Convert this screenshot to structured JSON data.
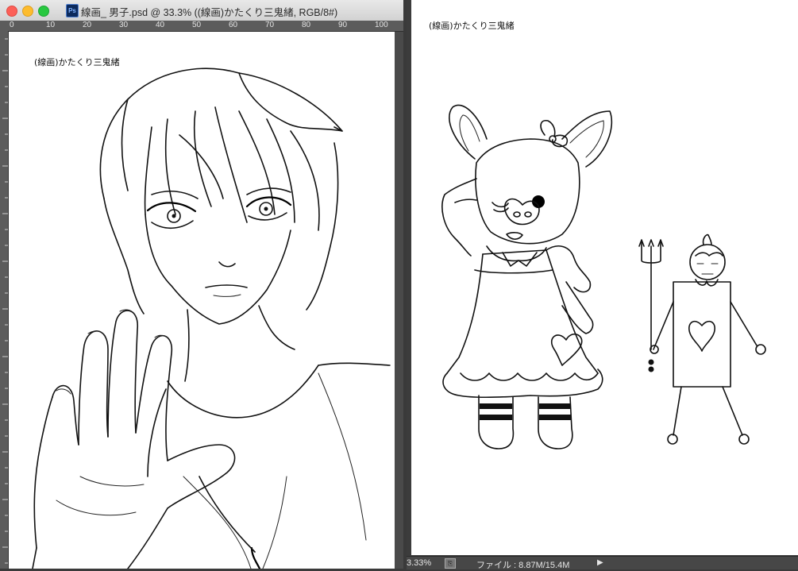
{
  "window1": {
    "title": "線画_ 男子.psd @ 33.3% ((線画)かたくり三鬼緒, RGB/8#)",
    "app_icon_label": "Ps",
    "ruler_labels": [
      "0",
      "10",
      "20",
      "30",
      "40",
      "50",
      "60",
      "70",
      "80",
      "90",
      "100"
    ],
    "watermark": "(線画)かたくり三鬼緒",
    "artwork": "boy-line-art-icon"
  },
  "window2": {
    "watermark": "(線画)かたくり三鬼緒",
    "artwork": "pig-and-card-soldier-line-art-icon"
  },
  "statusbar": {
    "zoom": "3.33%",
    "file_info": "ファイル : 8.87M/15.4M",
    "arrow": "▶"
  },
  "colors": {
    "close": "#fc5f57",
    "minimize": "#fdbc2e",
    "maximize": "#28c840",
    "canvas": "#ffffff"
  }
}
